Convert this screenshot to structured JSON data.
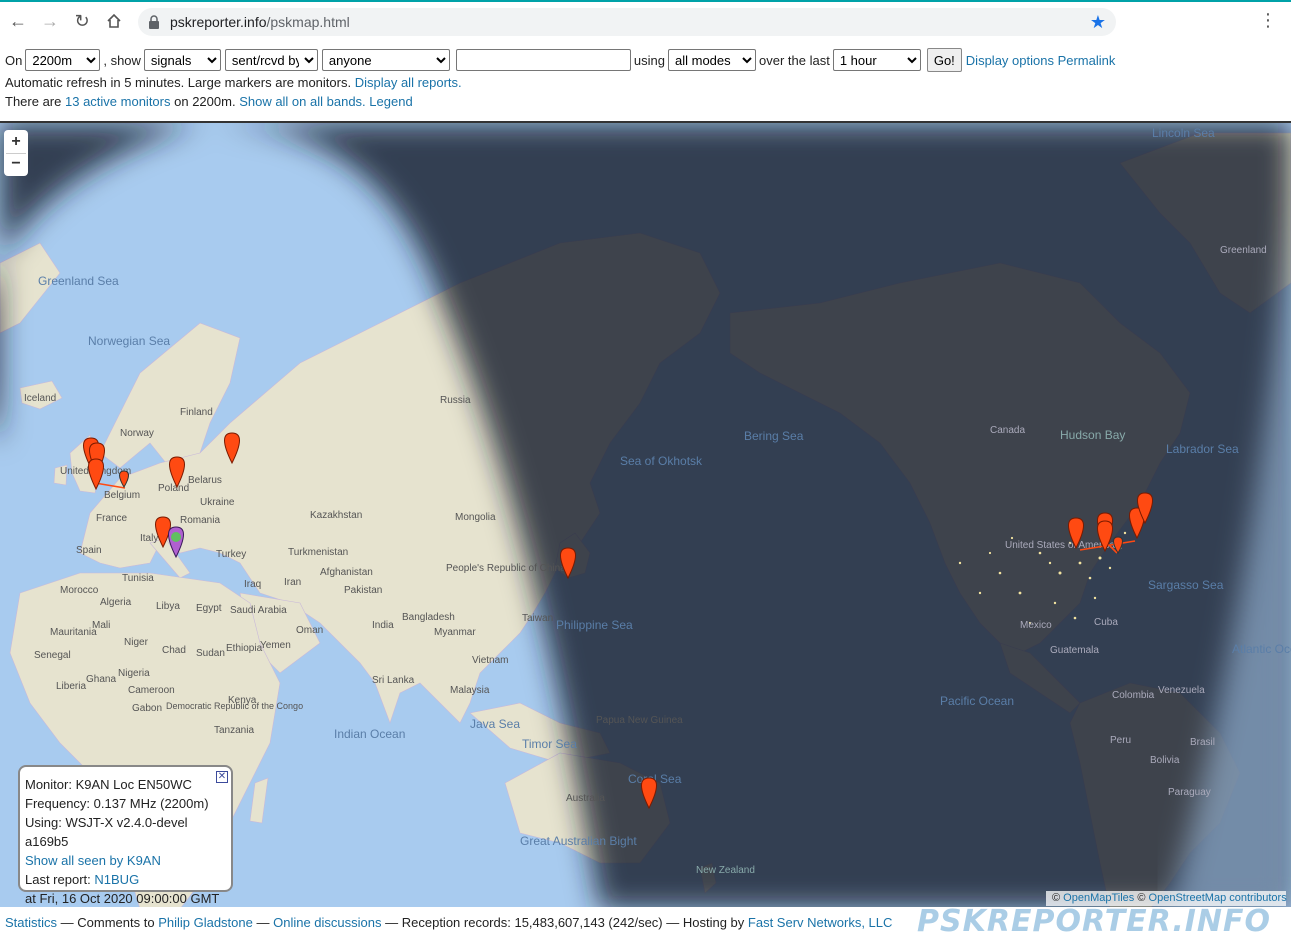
{
  "browser": {
    "url_host": "pskreporter.info",
    "url_path": "/pskmap.html",
    "back_icon": "arrow-left-icon",
    "forward_icon": "arrow-right-icon",
    "reload_icon": "reload-icon",
    "home_icon": "home-icon",
    "bookmark_icon": "star-icon",
    "menu_icon": "kebab-menu-icon",
    "accent_color": "#1a73e8"
  },
  "controls": {
    "on_label": "On",
    "band_value": "2200m",
    "show_label": ", show",
    "show_value": "signals",
    "direction_value": "sent/rcvd by",
    "who_value": "anyone",
    "callsign_value": "",
    "using_label": "using",
    "modes_value": "all modes",
    "over_label": "over the last",
    "period_value": "1 hour",
    "go_label": "Go!",
    "display_options_link": "Display options",
    "permalink_link": "Permalink"
  },
  "info": {
    "refresh_text": "Automatic refresh in 5 minutes. Large markers are monitors.",
    "display_all_link": "Display all reports.",
    "there_are": "There are",
    "active_monitors_link": "13 active monitors",
    "on_band_text": "on 2200m.",
    "show_all_link": "Show all on all bands.",
    "legend_link": "Legend"
  },
  "map": {
    "zoom_in": "+",
    "zoom_out": "−",
    "ocean_color": "#a8cbef",
    "land_color": "#e6e3cf",
    "night_color": "#1f2a3a",
    "marker_color": "#ff4a12",
    "labels": {
      "greenland_sea": "Greenland Sea",
      "norwegian_sea": "Norwegian Sea",
      "iceland": "Iceland",
      "finland": "Finland",
      "russia": "Russia",
      "norway": "Norway",
      "united_kingdom": "United Kingdom",
      "belgium": "Belgium",
      "france": "France",
      "spain": "Spain",
      "italy": "Italy",
      "poland": "Poland",
      "belarus": "Belarus",
      "ukraine": "Ukraine",
      "romania": "Romania",
      "turkey": "Turkey",
      "kazakhstan": "Kazakhstan",
      "mongolia": "Mongolia",
      "turkmenistan": "Turkmenistan",
      "iran": "Iran",
      "iraq": "Iraq",
      "afghanistan": "Afghanistan",
      "pakistan": "Pakistan",
      "india": "India",
      "china": "People's Republic of China",
      "bangladesh": "Bangladesh",
      "myanmar": "Myanmar",
      "taiwan": "Taiwan",
      "vietnam": "Vietnam",
      "sri_lanka": "Sri Lanka",
      "malaysia": "Malaysia",
      "java_sea": "Java Sea",
      "indian_ocean": "Indian Ocean",
      "timor_sea": "Timor Sea",
      "papua": "Papua New Guinea",
      "coral_sea": "Coral Sea",
      "australia": "Australia",
      "great_bight": "Great Australian Bight",
      "new_zealand": "New Zealand",
      "philippine_sea": "Philippine Sea",
      "sea_okhotsk": "Sea of Okhotsk",
      "bering_sea": "Bering Sea",
      "pacific_ocean": "Pacific Ocean",
      "hudson_bay": "Hudson Bay",
      "canada": "Canada",
      "labrador_sea": "Labrador Sea",
      "lincoln_sea": "Lincoln Sea",
      "greenland": "Greenland",
      "united_states": "United States of America",
      "mexico": "Mexico",
      "cuba": "Cuba",
      "guatemala": "Guatemala",
      "sargasso_sea": "Sargasso Sea",
      "atlantic_ocean": "Atlantic Ocean",
      "colombia": "Colombia",
      "venezuela": "Venezuela",
      "peru": "Peru",
      "brazil": "Brasil",
      "bolivia": "Bolivia",
      "paraguay": "Paraguay",
      "tunisia": "Tunisia",
      "morocco": "Morocco",
      "algeria": "Algeria",
      "libya": "Libya",
      "egypt": "Egypt",
      "mauritania": "Mauritania",
      "mali": "Mali",
      "niger": "Niger",
      "chad": "Chad",
      "sudan": "Sudan",
      "senegal": "Senegal",
      "ethiopia": "Ethiopia",
      "yemen": "Yemen",
      "oman": "Oman",
      "saudi_arabia": "Saudi Arabia",
      "nigeria": "Nigeria",
      "liberia": "Liberia",
      "ghana": "Ghana",
      "cameroon": "Cameroon",
      "gabon": "Gabon",
      "kenya": "Kenya",
      "drc": "Democratic Republic of the Congo",
      "tanzania": "Tanzania"
    }
  },
  "popup": {
    "close_icon": "close-icon",
    "monitor": "Monitor: K9AN Loc EN50WC",
    "frequency": "Frequency: 0.137 MHz (2200m)",
    "using": "Using: WSJT-X v2.4.0-devel a169b5",
    "show_all_link": "Show all seen by K9AN",
    "last_report_label": "Last report:",
    "last_report_call": "N1BUG",
    "timestamp": "at Fri, 16 Oct 2020 09:00:00 GMT"
  },
  "attribution": {
    "copy1": "©",
    "openmaptiles": "OpenMapTiles",
    "copy2": "©",
    "osm": "OpenStreetMap contributors"
  },
  "footer": {
    "statistics": "Statistics",
    "comments_to": "— Comments to",
    "author": "Philip Gladstone",
    "dash1": "—",
    "online_discussions": "Online discussions",
    "records_text": "— Reception records: 15,483,607,143 (242/sec) — Hosting by",
    "hosting": "Fast Serv Networks, LLC",
    "brand": "PSKREPORTER.INFO"
  }
}
